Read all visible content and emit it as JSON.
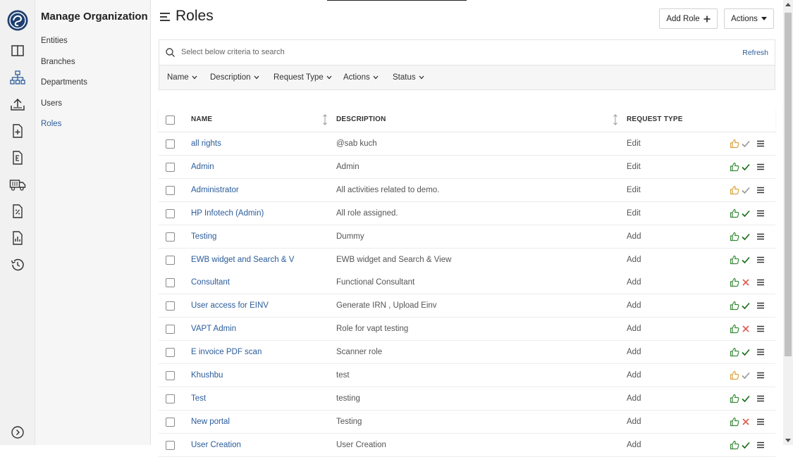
{
  "sidebar": {
    "title": "Manage Organization",
    "items": [
      {
        "label": "Entities"
      },
      {
        "label": "Branches"
      },
      {
        "label": "Departments"
      },
      {
        "label": "Users"
      },
      {
        "label": "Roles",
        "active": true
      }
    ]
  },
  "header": {
    "title": "Roles",
    "add_role_label": "Add Role",
    "actions_label": "Actions"
  },
  "search": {
    "placeholder": "Select below criteria to search",
    "refresh_label": "Refresh"
  },
  "filters": [
    "Name",
    "Description",
    "Request Type",
    "Actions",
    "Status"
  ],
  "table": {
    "columns": [
      "NAME",
      "DESCRIPTION",
      "REQUEST TYPE"
    ],
    "rows": [
      {
        "name": "all rights",
        "description": "@sab kuch",
        "request_type": "Edit",
        "approve": "pending",
        "status": "approved-muted"
      },
      {
        "name": "Admin",
        "description": "Admin",
        "request_type": "Edit",
        "approve": "done",
        "status": "approved"
      },
      {
        "name": "Administrator",
        "description": "All activities related to demo.",
        "request_type": "Edit",
        "approve": "pending",
        "status": "approved-muted"
      },
      {
        "name": "HP Infotech (Admin)",
        "description": "All role assigned.",
        "request_type": "Edit",
        "approve": "done",
        "status": "approved"
      },
      {
        "name": "Testing",
        "description": "Dummy",
        "request_type": "Add",
        "approve": "done",
        "status": "approved"
      },
      {
        "name": "EWB widget and Search & V",
        "description": "EWB widget and Search & View",
        "request_type": "Add",
        "approve": "done",
        "status": "approved"
      },
      {
        "name": "Consultant",
        "description": "Functional Consultant",
        "request_type": "Add",
        "approve": "done",
        "status": "rejected"
      },
      {
        "name": "User access for EINV",
        "description": "Generate IRN , Upload Einv",
        "request_type": "Add",
        "approve": "done",
        "status": "approved"
      },
      {
        "name": "VAPT Admin",
        "description": "Role for vapt testing",
        "request_type": "Add",
        "approve": "done",
        "status": "rejected"
      },
      {
        "name": "E invoice PDF scan",
        "description": "Scanner role",
        "request_type": "Add",
        "approve": "done",
        "status": "approved"
      },
      {
        "name": "Khushbu",
        "description": "test",
        "request_type": "Add",
        "approve": "pending",
        "status": "approved-muted"
      },
      {
        "name": "Test",
        "description": "testing",
        "request_type": "Add",
        "approve": "done",
        "status": "approved"
      },
      {
        "name": "New portal",
        "description": "Testing",
        "request_type": "Add",
        "approve": "done",
        "status": "rejected"
      },
      {
        "name": "User Creation",
        "description": "User Creation",
        "request_type": "Add",
        "approve": "done",
        "status": "approved"
      }
    ]
  },
  "colors": {
    "link": "#2b5c9a",
    "approve_done": "#3a8a3a",
    "approve_pending": "#d9a441",
    "reject": "#e05a4f",
    "check_muted": "#9a9a9a",
    "check_done": "#1e6e1e"
  },
  "icons": {
    "rail": [
      "logo-icon",
      "layout-icon",
      "org-chart-icon",
      "upload-icon",
      "add-document-icon",
      "e-document-icon",
      "truck-icon",
      "tax-document-icon",
      "report-icon",
      "history-icon",
      "expand-icon"
    ],
    "header": "hamburger-menu-icon",
    "search": "search-icon",
    "row_actions": [
      "thumbs-up-icon",
      "check-icon",
      "cross-icon",
      "menu-icon"
    ]
  }
}
